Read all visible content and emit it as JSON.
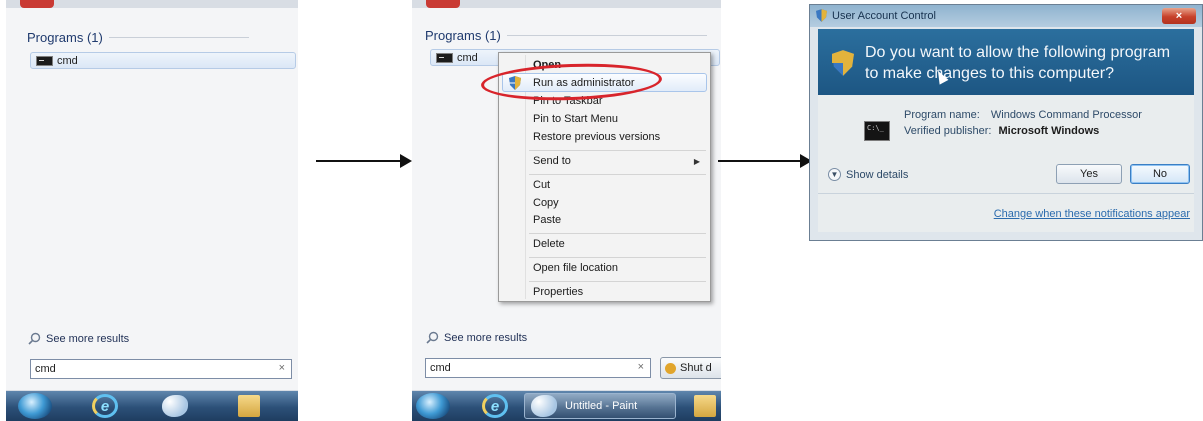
{
  "step1": {
    "section_header": "Programs (1)",
    "program_item": "cmd",
    "see_more": "See more results",
    "search_value": "cmd",
    "clear_symbol": "×"
  },
  "step2": {
    "section_header": "Programs (1)",
    "program_item": "cmd",
    "context_menu": {
      "open": "Open",
      "run_as_admin": "Run as administrator",
      "pin_taskbar": "Pin to Taskbar",
      "pin_start": "Pin to Start Menu",
      "restore": "Restore previous versions",
      "send_to": "Send to",
      "cut": "Cut",
      "copy": "Copy",
      "paste": "Paste",
      "delete": "Delete",
      "open_location": "Open file location",
      "properties": "Properties"
    },
    "see_more": "See more results",
    "search_value": "cmd",
    "clear_symbol": "×",
    "shutdown_label": "Shut d",
    "taskbar_paint": "Untitled - Paint",
    "highlight_color": "#d8242b"
  },
  "step3": {
    "title": "User Account Control",
    "close_symbol": "×",
    "question": "Do you want to allow the following program to make changes to this computer?",
    "program_name_label": "Program name:",
    "program_name_value": "Windows Command Processor",
    "publisher_label": "Verified publisher:",
    "publisher_value": "Microsoft Windows",
    "show_details": "Show details",
    "yes_button": "Yes",
    "no_button": "No",
    "change_link": "Change when these notifications appear",
    "icon_text": "C:\\_"
  },
  "icons": {
    "search": "magnifier-icon",
    "shield": "uac-shield-icon",
    "arrow": "right-arrow-icon"
  }
}
